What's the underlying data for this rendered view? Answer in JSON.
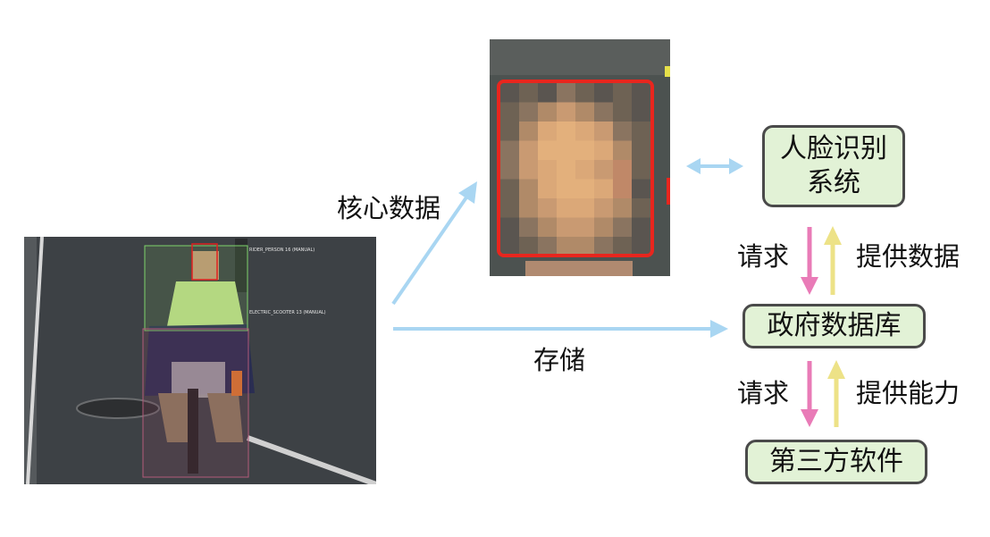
{
  "labels": {
    "core_data": "核心数据",
    "storage": "存储",
    "request_1": "请求",
    "provide_data": "提供数据",
    "request_2": "请求",
    "provide_capability": "提供能力"
  },
  "nodes": {
    "face_system_line1": "人脸识别",
    "face_system_line2": "系统",
    "gov_db": "政府数据库",
    "third_party": "第三方软件"
  },
  "street_image": {
    "person_tag": "RIDER_PERSON 16 (MANUAL)",
    "scooter_tag": "ELECTRIC_SCOOTER 13 (MANUAL)"
  },
  "colors": {
    "box_fill": "#e2f2d6",
    "box_border": "#4a4a4a",
    "blue_arrow": "#a9d6f2",
    "pink_arrow": "#e97bb7",
    "yellow_arrow": "#ede287",
    "face_frame": "#e8261e"
  }
}
